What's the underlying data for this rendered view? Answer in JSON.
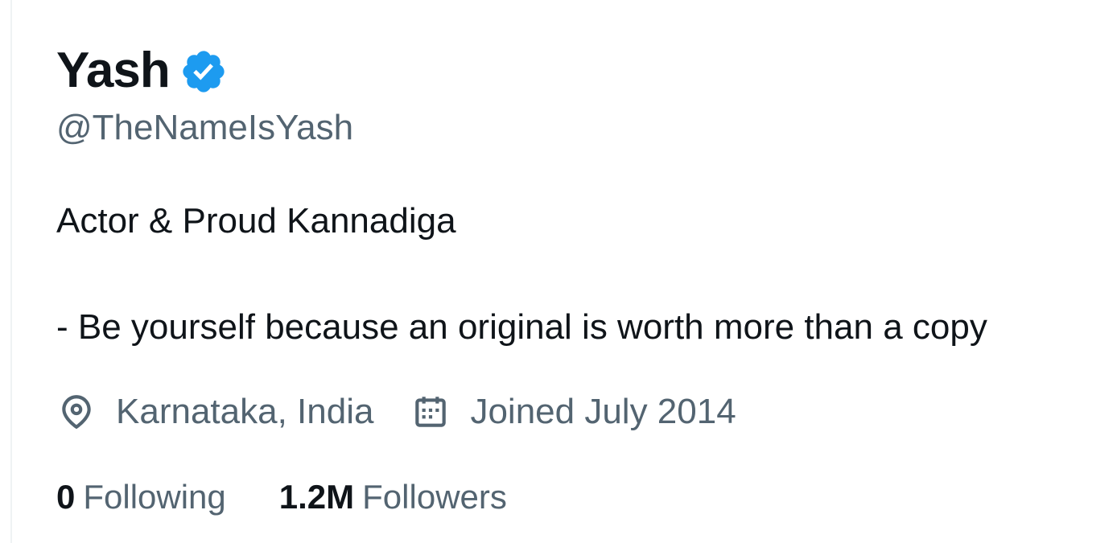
{
  "profile": {
    "display_name": "Yash",
    "verified_icon": "verified-badge-icon",
    "handle": "@TheNameIsYash",
    "bio": {
      "line1": "Actor & Proud Kannadiga",
      "line2": "- Be yourself because an original is worth more than a copy"
    },
    "location": {
      "icon": "location-pin-icon",
      "text": "Karnataka, India"
    },
    "joined": {
      "icon": "calendar-icon",
      "text": "Joined July 2014"
    },
    "following": {
      "count": "0",
      "label": "Following"
    },
    "followers": {
      "count": "1.2M",
      "label": "Followers"
    }
  },
  "colors": {
    "primary_text": "#0f1419",
    "secondary_text": "#536471",
    "verified_blue": "#1d9bf0",
    "border": "#eff3f4"
  }
}
